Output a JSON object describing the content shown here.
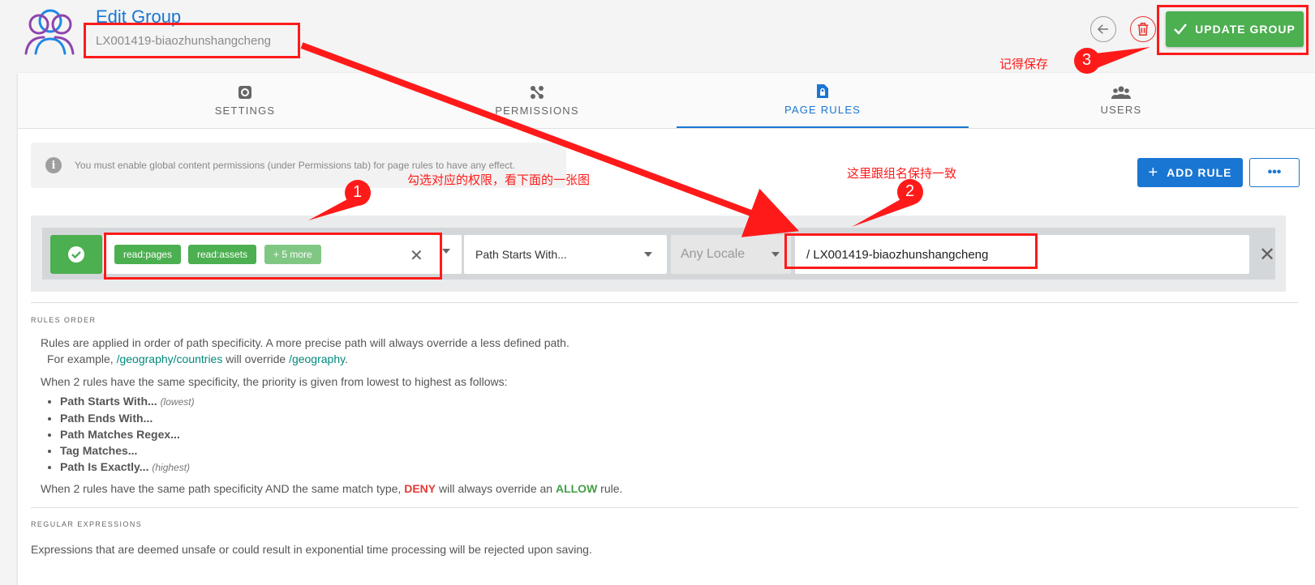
{
  "header": {
    "title": "Edit Group",
    "subtitle": "LX001419-biaozhunshangcheng",
    "update_label": "UPDATE GROUP"
  },
  "tabs": [
    {
      "label": "SETTINGS",
      "icon": "gear-icon"
    },
    {
      "label": "PERMISSIONS",
      "icon": "nodes-icon"
    },
    {
      "label": "PAGE RULES",
      "icon": "file-lock-icon",
      "active": true
    },
    {
      "label": "USERS",
      "icon": "users-icon"
    }
  ],
  "info": {
    "message": "You must enable global content permissions (under Permissions tab) for page rules to have any effect."
  },
  "toolbar": {
    "add_rule_label": "ADD RULE",
    "more_label": "•••"
  },
  "rule": {
    "chips": [
      "read:pages",
      "read:assets",
      "+ 5 more"
    ],
    "match": "Path Starts With...",
    "locale_placeholder": "Any Locale",
    "path": "/ LX001419-biaozhunshangcheng"
  },
  "rules_order": {
    "heading": "RULES ORDER",
    "line1": "Rules are applied in order of path specificity. A more precise path will always override a less defined path.",
    "example_prefix": "For example, ",
    "example_link1": "/geography/countries",
    "example_mid": " will override ",
    "example_link2": "/geography",
    "example_suffix": ".",
    "line2": "When 2 rules have the same specificity, the priority is given from lowest to highest as follows:",
    "list": [
      {
        "label": "Path Starts With...",
        "note": "(lowest)"
      },
      {
        "label": "Path Ends With...",
        "note": ""
      },
      {
        "label": "Path Matches Regex...",
        "note": ""
      },
      {
        "label": "Tag Matches...",
        "note": ""
      },
      {
        "label": "Path Is Exactly...",
        "note": "(highest)"
      }
    ],
    "final_prefix": "When 2 rules have the same path specificity AND the same match type, ",
    "deny": "DENY",
    "final_mid": " will always override an ",
    "allow": "ALLOW",
    "final_suffix": " rule."
  },
  "regex": {
    "heading": "REGULAR EXPRESSIONS",
    "text": "Expressions that are deemed unsafe or could result in exponential time processing will be rejected upon saving."
  },
  "annotations": {
    "note1": "勾选对应的权限，看下面的一张图",
    "note2": "这里跟组名保持一致",
    "note3": "记得保存",
    "num1": "1",
    "num2": "2",
    "num3": "3"
  },
  "colors": {
    "primary": "#1976d2",
    "success": "#4caf50",
    "danger": "#e53935",
    "annotation": "#ff1a1a"
  }
}
